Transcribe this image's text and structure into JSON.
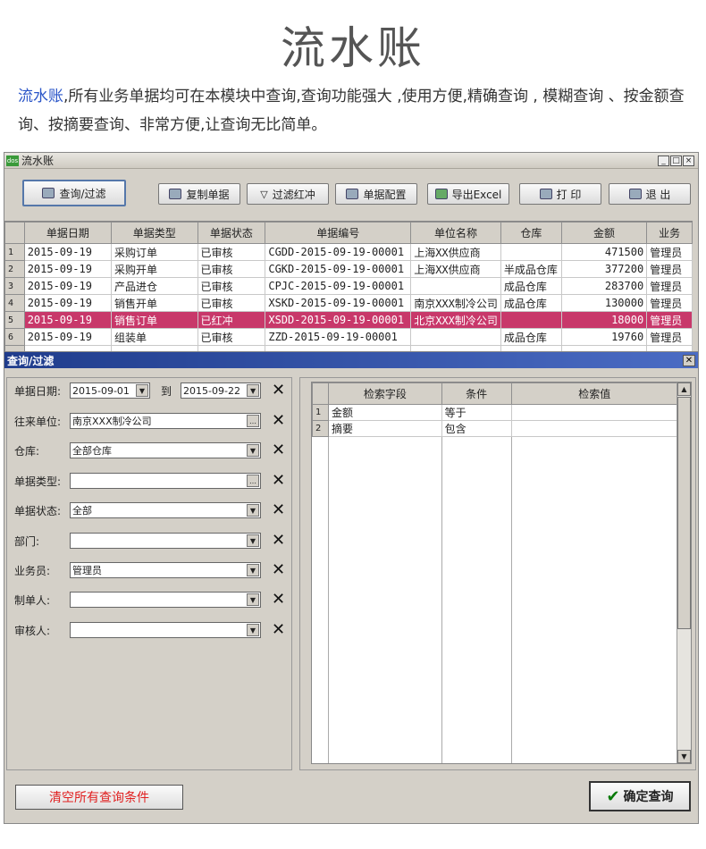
{
  "hero": {
    "title": "流水账"
  },
  "intro": {
    "highlight": "流水账",
    "text": ",所有业务单据均可在本模块中查询,查询功能强大 ,使用方便,精确查询 , 模糊查询 、按金额查询、按摘要查询、非常方便,让查询无比简单。"
  },
  "window": {
    "title": "流水账",
    "app_icon": "dos",
    "controls": [
      "_",
      "□",
      "×"
    ]
  },
  "toolbar": {
    "query_filter": "查询/过滤",
    "copy_doc": "复制单据",
    "filter_red": "过滤红冲",
    "doc_config": "单据配置",
    "export_excel": "导出Excel",
    "print": "打  印",
    "exit": "退  出"
  },
  "grid": {
    "columns": [
      "单据日期",
      "单据类型",
      "单据状态",
      "单据编号",
      "单位名称",
      "仓库",
      "金额",
      "业务"
    ],
    "rows": [
      {
        "n": "1",
        "date": "2015-09-19",
        "type": "采购订单",
        "status": "已审核",
        "no": "CGDD-2015-09-19-00001",
        "unit": "上海XX供应商",
        "wh": "",
        "amount": "471500",
        "clerk": "管理员"
      },
      {
        "n": "2",
        "date": "2015-09-19",
        "type": "采购开单",
        "status": "已审核",
        "no": "CGKD-2015-09-19-00001",
        "unit": "上海XX供应商",
        "wh": "半成品仓库",
        "amount": "377200",
        "clerk": "管理员"
      },
      {
        "n": "3",
        "date": "2015-09-19",
        "type": "产品进仓",
        "status": "已审核",
        "no": "CPJC-2015-09-19-00001",
        "unit": "",
        "wh": "成品仓库",
        "amount": "283700",
        "clerk": "管理员"
      },
      {
        "n": "4",
        "date": "2015-09-19",
        "type": "销售开单",
        "status": "已审核",
        "no": "XSKD-2015-09-19-00001",
        "unit": "南京XXX制冷公司",
        "wh": "成品仓库",
        "amount": "130000",
        "clerk": "管理员"
      },
      {
        "n": "5",
        "date": "2015-09-19",
        "type": "销售订单",
        "status": "已红冲",
        "no": "XSDD-2015-09-19-00001",
        "unit": "北京XXX制冷公司",
        "wh": "",
        "amount": "18000",
        "clerk": "管理员"
      },
      {
        "n": "6",
        "date": "2015-09-19",
        "type": "组装单",
        "status": "已审核",
        "no": "ZZD-2015-09-19-00001",
        "unit": "",
        "wh": "成品仓库",
        "amount": "19760",
        "clerk": "管理员"
      }
    ],
    "selected_row": 4
  },
  "panel": {
    "title": "查询/过滤",
    "date_label": "单据日期:",
    "date_from": "2015-09-01",
    "to_label": "到",
    "date_to": "2015-09-22",
    "unit_label": "往来单位:",
    "unit_value": "南京XXX制冷公司",
    "warehouse_label": "仓库:",
    "warehouse_value": "全部仓库",
    "doctype_label": "单据类型:",
    "doctype_value": "",
    "status_label": "单据状态:",
    "status_value": "全部",
    "dept_label": "部门:",
    "dept_value": "",
    "clerk_label": "业务员:",
    "clerk_value": "管理员",
    "maker_label": "制单人:",
    "maker_value": "",
    "auditor_label": "审核人:",
    "auditor_value": "",
    "cond_columns": [
      "检索字段",
      "条件",
      "检索值"
    ],
    "conds": [
      {
        "n": "1",
        "field": "金额",
        "op": "等于",
        "value": ""
      },
      {
        "n": "2",
        "field": "摘要",
        "op": "包含",
        "value": ""
      }
    ],
    "clear_all": "清空所有查询条件",
    "confirm": "确定查询"
  }
}
